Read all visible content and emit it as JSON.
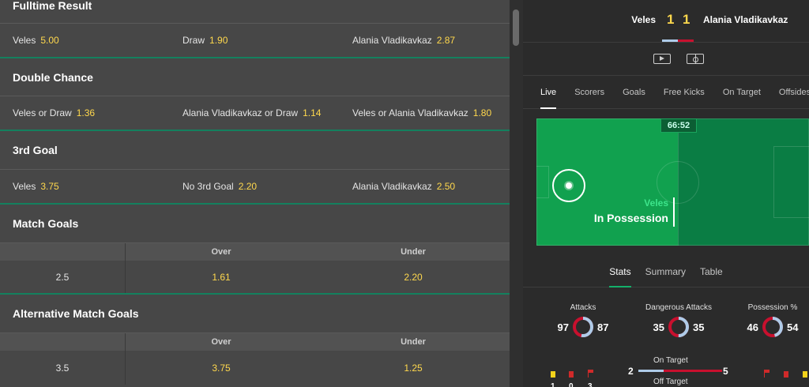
{
  "markets": {
    "fulltime": {
      "title": "Fulltime Result",
      "sel": [
        {
          "label": "Veles",
          "odds": "5.00"
        },
        {
          "label": "Draw",
          "odds": "1.90"
        },
        {
          "label": "Alania Vladikavkaz",
          "odds": "2.87"
        }
      ]
    },
    "double_chance": {
      "title": "Double Chance",
      "sel": [
        {
          "label": "Veles or Draw",
          "odds": "1.36"
        },
        {
          "label": "Alania Vladikavkaz or Draw",
          "odds": "1.14"
        },
        {
          "label": "Veles or Alania Vladikavkaz",
          "odds": "1.80"
        }
      ]
    },
    "third_goal": {
      "title": "3rd Goal",
      "sel": [
        {
          "label": "Veles",
          "odds": "3.75"
        },
        {
          "label": "No 3rd Goal",
          "odds": "2.20"
        },
        {
          "label": "Alania Vladikavkaz",
          "odds": "2.50"
        }
      ]
    },
    "match_goals": {
      "title": "Match Goals",
      "head": [
        "Over",
        "Under"
      ],
      "line": "2.5",
      "over": "1.61",
      "under": "2.20"
    },
    "alt_match_goals": {
      "title": "Alternative Match Goals",
      "head": [
        "Over",
        "Under"
      ],
      "line": "3.5",
      "over": "3.75",
      "under": "1.25"
    }
  },
  "scoreboard": {
    "home": "Veles",
    "away": "Alania Vladikavkaz",
    "home_score": "1",
    "away_score": "1"
  },
  "tabs": [
    "Live",
    "Scorers",
    "Goals",
    "Free Kicks",
    "On Target",
    "Offsides"
  ],
  "pitch": {
    "clock": "66:52",
    "team": "Veles",
    "status": "In Possession"
  },
  "stat_tabs": [
    "Stats",
    "Summary",
    "Table"
  ],
  "stats": {
    "attacks": {
      "title": "Attacks",
      "home": "97",
      "away": "87"
    },
    "dangerous": {
      "title": "Dangerous Attacks",
      "home": "35",
      "away": "35"
    },
    "possession": {
      "title": "Possession %",
      "home": "46",
      "away": "54"
    },
    "on_target": {
      "title": "On Target",
      "home": "2",
      "away": "5"
    },
    "off_target": {
      "title": "Off Target"
    },
    "home_counts": {
      "yellow": "1",
      "red": "0",
      "corners": "3"
    }
  },
  "colors": {
    "odds": "#ffd84d",
    "home": "#aecbe8",
    "away": "#c8102e",
    "accent": "#14805e"
  }
}
